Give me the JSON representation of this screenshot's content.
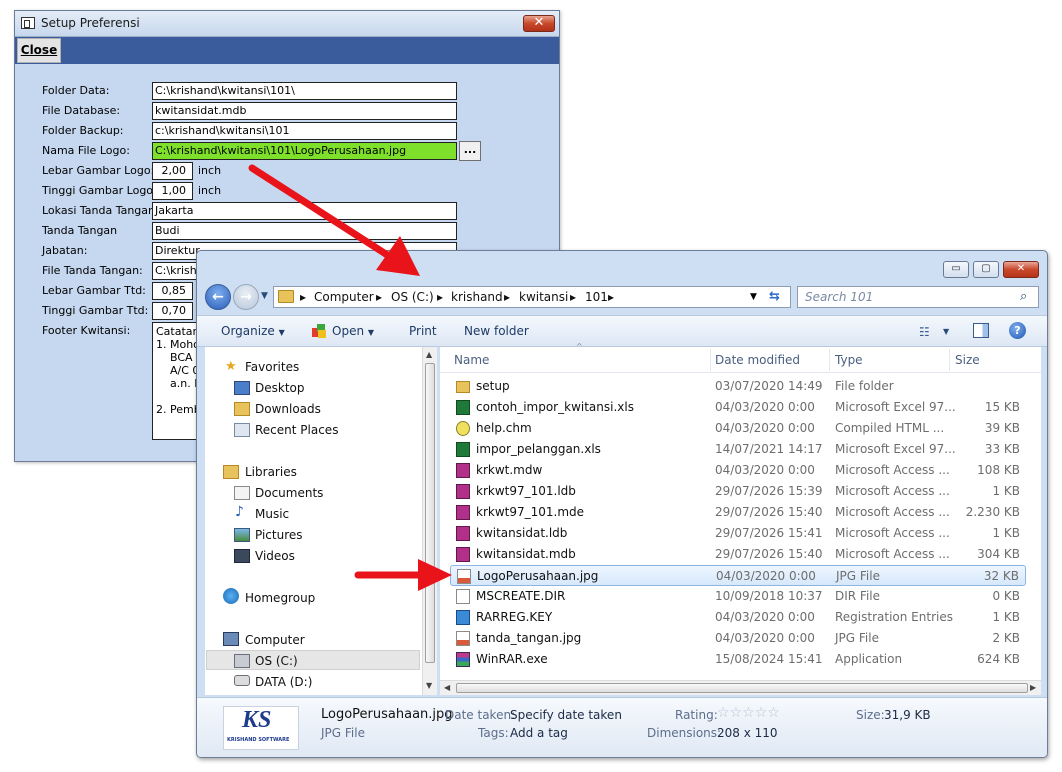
{
  "setup_window": {
    "title": "Setup Preferensi",
    "close_x": "✕",
    "menu_close": "Close",
    "labels": {
      "folder_data": "Folder Data:",
      "file_database": "File Database:",
      "folder_backup": "Folder Backup:",
      "nama_file_logo": "Nama File Logo:",
      "lebar_gambar_logo": "Lebar Gambar Logo:",
      "tinggi_gambar_logo": "Tinggi Gambar Logo:",
      "lokasi_tanda_tangan": "Lokasi Tanda Tangan",
      "tanda_tangan": "Tanda Tangan",
      "jabatan": "Jabatan:",
      "file_tanda_tangan": "File Tanda Tangan:",
      "lebar_gambar_ttd": "Lebar Gambar Ttd:",
      "tinggi_gambar_ttd": "Tinggi Gambar Ttd:",
      "footer_kwitansi": "Footer Kwitansi:"
    },
    "values": {
      "folder_data": "C:\\krishand\\kwitansi\\101\\",
      "file_database": "kwitansidat.mdb",
      "folder_backup": "c:\\krishand\\kwitansi\\101",
      "nama_file_logo": "C:\\krishand\\kwitansi\\101\\LogoPerusahaan.jpg",
      "lebar_gambar_logo": "2,00",
      "tinggi_gambar_logo": "1,00",
      "lokasi_tanda_tangan": "Jakarta",
      "tanda_tangan": "Budi",
      "jabatan": "Direktur",
      "file_tanda_tangan": "C:\\krisha",
      "lebar_gambar_ttd": "0,85",
      "tinggi_gambar_ttd": "0,70",
      "footer_kwitansi": "Catatan\n1. Mohor\n    BCA 0\n    A/C 0\n    a.n. P\n\n2. Pemba"
    },
    "unit": "inch",
    "browse_label": "..."
  },
  "explorer": {
    "caption_buttons": {
      "minimize": "▭",
      "maximize": "▢",
      "close": "✕"
    },
    "breadcrumbs": [
      "Computer",
      "OS (C:)",
      "krishand",
      "kwitansi",
      "101"
    ],
    "search_placeholder": "Search 101",
    "toolbar": {
      "organize": "Organize",
      "open": "Open",
      "print": "Print",
      "new_folder": "New folder"
    },
    "nav": {
      "favorites": "Favorites",
      "desktop": "Desktop",
      "downloads": "Downloads",
      "recent_places": "Recent Places",
      "libraries": "Libraries",
      "documents": "Documents",
      "music": "Music",
      "pictures": "Pictures",
      "videos": "Videos",
      "homegroup": "Homegroup",
      "computer": "Computer",
      "os_c": "OS (C:)",
      "data_d": "DATA (D:)"
    },
    "columns": {
      "name": "Name",
      "date": "Date modified",
      "type": "Type",
      "size": "Size"
    },
    "files": [
      {
        "name": "setup",
        "date": "03/07/2020 14:49",
        "type": "File folder",
        "size": "",
        "icon": "folder-icon"
      },
      {
        "name": "contoh_impor_kwitansi.xls",
        "date": "04/03/2020 0:00",
        "type": "Microsoft Excel 97...",
        "size": "15 KB",
        "icon": "excel-icon"
      },
      {
        "name": "help.chm",
        "date": "04/03/2020 0:00",
        "type": "Compiled HTML ...",
        "size": "39 KB",
        "icon": "help-icon"
      },
      {
        "name": "impor_pelanggan.xls",
        "date": "14/07/2021 14:17",
        "type": "Microsoft Excel 97...",
        "size": "33 KB",
        "icon": "excel-icon"
      },
      {
        "name": "krkwt.mdw",
        "date": "04/03/2020 0:00",
        "type": "Microsoft Access ...",
        "size": "108 KB",
        "icon": "access-icon"
      },
      {
        "name": "krkwt97_101.ldb",
        "date": "29/07/2026 15:39",
        "type": "Microsoft Access ...",
        "size": "1 KB",
        "icon": "access-icon"
      },
      {
        "name": "krkwt97_101.mde",
        "date": "29/07/2026 15:40",
        "type": "Microsoft Access ...",
        "size": "2.230 KB",
        "icon": "access-icon"
      },
      {
        "name": "kwitansidat.ldb",
        "date": "29/07/2026 15:41",
        "type": "Microsoft Access ...",
        "size": "1 KB",
        "icon": "access-icon"
      },
      {
        "name": "kwitansidat.mdb",
        "date": "29/07/2026 15:40",
        "type": "Microsoft Access ...",
        "size": "304 KB",
        "icon": "access-icon"
      },
      {
        "name": "LogoPerusahaan.jpg",
        "date": "04/03/2020 0:00",
        "type": "JPG File",
        "size": "32 KB",
        "icon": "jpg-icon",
        "selected": true
      },
      {
        "name": "MSCREATE.DIR",
        "date": "10/09/2018 10:37",
        "type": "DIR File",
        "size": "0 KB",
        "icon": "blank-file-icon"
      },
      {
        "name": "RARREG.KEY",
        "date": "04/03/2020 0:00",
        "type": "Registration Entries",
        "size": "1 KB",
        "icon": "registry-icon"
      },
      {
        "name": "tanda_tangan.jpg",
        "date": "04/03/2020 0:00",
        "type": "JPG File",
        "size": "2 KB",
        "icon": "jpg-icon"
      },
      {
        "name": "WinRAR.exe",
        "date": "15/08/2024 15:41",
        "type": "Application",
        "size": "624 KB",
        "icon": "winrar-icon"
      }
    ],
    "details": {
      "filename": "LogoPerusahaan.jpg",
      "filetype": "JPG File",
      "date_taken_label": "Date taken:",
      "date_taken_value": "Specify date taken",
      "tags_label": "Tags:",
      "tags_value": "Add a tag",
      "rating_label": "Rating:",
      "rating_value": 0,
      "dimensions_label": "Dimensions:",
      "dimensions_value": "208 x 110",
      "size_label": "Size:",
      "size_value": "31,9 KB",
      "thumb_logo_text": "KS",
      "thumb_brand": "KRISHAND SOFTWARE"
    }
  },
  "colors": {
    "setup_bg": "#c6d8f0",
    "menubar": "#3b5c9c",
    "logo_field": "#7ee02a",
    "arrow": "#e8141a",
    "selection": "#d6e8fb"
  }
}
